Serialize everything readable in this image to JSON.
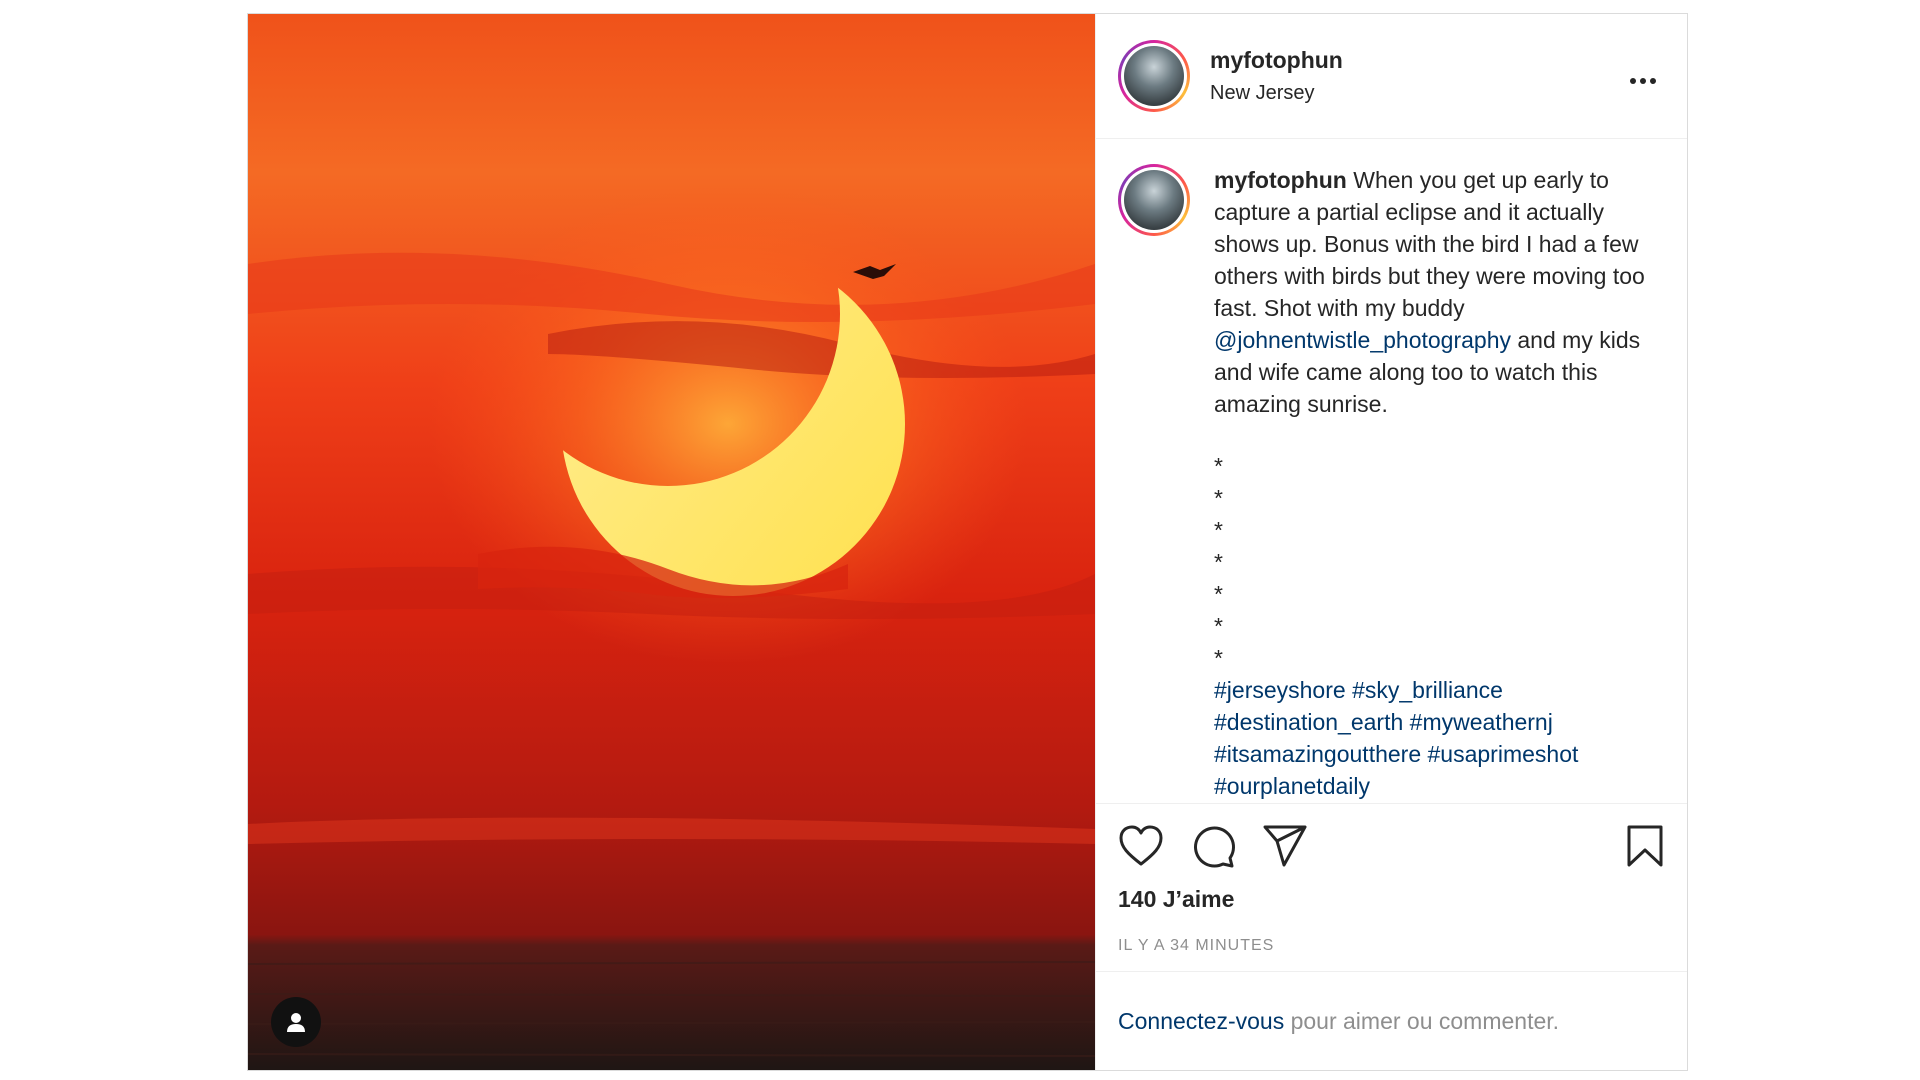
{
  "post": {
    "author": "myfotophun",
    "location": "New Jersey",
    "caption": {
      "author": "myfotophun",
      "text_before_mention": "When you get up early to capture a partial eclipse and it actually shows up. Bonus with the bird I had a few others with birds but they were moving too fast. Shot with my buddy",
      "mention": "@johnentwistle_photography",
      "text_after_mention": "and my kids and wife came along too to watch this amazing sunrise.",
      "stars": [
        "*",
        "*",
        "*",
        "*",
        "*",
        "*",
        "*"
      ],
      "hashtags": [
        "#jerseyshore",
        "#sky_brilliance",
        "#destination_earth",
        "#myweathernj",
        "#itsamazingoutthere",
        "#usaprimeshot",
        "#ourplanetdaily"
      ]
    },
    "likes": "140 J’aime",
    "time": "IL Y A 34 MINUTES"
  },
  "login": {
    "link": "Connectez-vous",
    "text": "pour aimer ou commenter."
  },
  "icons": {
    "more": "more-options-icon",
    "like": "heart-icon",
    "comment": "comment-icon",
    "share": "share-icon",
    "save": "bookmark-icon",
    "tag": "user-tag-icon"
  },
  "colors": {
    "link": "#00376b",
    "muted": "#8e8e8e",
    "text": "#262626"
  }
}
